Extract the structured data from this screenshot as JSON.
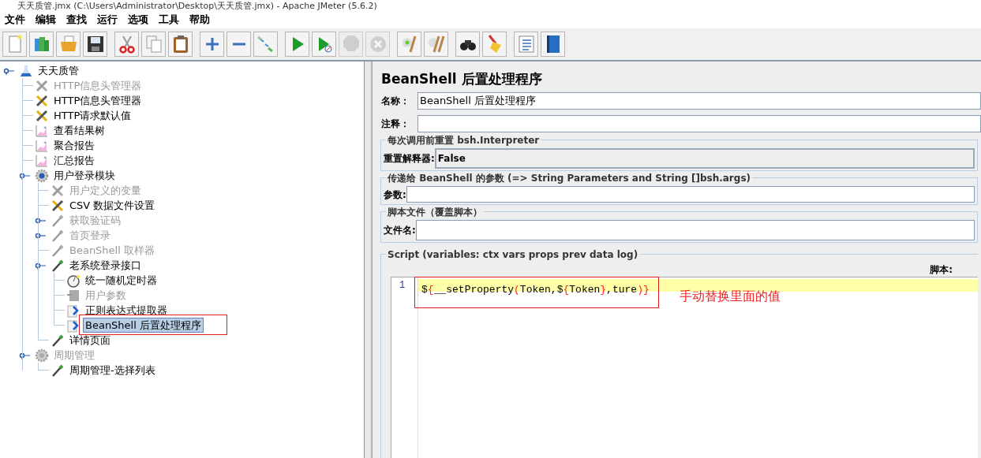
{
  "window": {
    "title": "天天质管.jmx (C:\\Users\\Administrator\\Desktop\\天天质管.jmx) - Apache JMeter (5.6.2)"
  },
  "menu": [
    "文件",
    "编辑",
    "查找",
    "运行",
    "选项",
    "工具",
    "帮助"
  ],
  "toolbar": [
    [
      {
        "kind": "new",
        "disabled": false
      },
      {
        "kind": "templates",
        "disabled": false
      },
      {
        "kind": "open",
        "disabled": false
      },
      {
        "kind": "save",
        "disabled": false
      }
    ],
    [
      {
        "kind": "cut",
        "disabled": false
      },
      {
        "kind": "copy",
        "disabled": false
      },
      {
        "kind": "paste",
        "disabled": false
      }
    ],
    [
      {
        "kind": "expand",
        "disabled": false
      },
      {
        "kind": "collapse",
        "disabled": false
      },
      {
        "kind": "toggle",
        "disabled": false
      }
    ],
    [
      {
        "kind": "start",
        "disabled": false
      },
      {
        "kind": "start-no-pause",
        "disabled": false
      },
      {
        "kind": "stop",
        "disabled": true
      },
      {
        "kind": "shutdown",
        "disabled": true
      }
    ],
    [
      {
        "kind": "clear",
        "disabled": false
      },
      {
        "kind": "clear-all",
        "disabled": false
      }
    ],
    [
      {
        "kind": "search",
        "disabled": false
      },
      {
        "kind": "reset-search",
        "disabled": false
      }
    ],
    [
      {
        "kind": "functions",
        "disabled": false
      },
      {
        "kind": "help",
        "disabled": false
      }
    ]
  ],
  "tree": [
    {
      "label": "天天质管",
      "kind": "plan",
      "disabled": false,
      "selected": false,
      "expanded": true,
      "children": [
        {
          "label": "HTTP信息头管理器",
          "kind": "config",
          "disabled": true,
          "selected": false
        },
        {
          "label": "HTTP信息头管理器",
          "kind": "config",
          "disabled": false,
          "selected": false
        },
        {
          "label": "HTTP请求默认值",
          "kind": "config",
          "disabled": false,
          "selected": false
        },
        {
          "label": "查看结果树",
          "kind": "listener",
          "disabled": false,
          "selected": false
        },
        {
          "label": "聚合报告",
          "kind": "listener",
          "disabled": false,
          "selected": false
        },
        {
          "label": "汇总报告",
          "kind": "listener",
          "disabled": false,
          "selected": false
        },
        {
          "label": "用户登录模块",
          "kind": "group",
          "disabled": false,
          "selected": false,
          "expanded": true,
          "children": [
            {
              "label": "用户定义的变量",
              "kind": "config",
              "disabled": true,
              "selected": false
            },
            {
              "label": "CSV 数据文件设置",
              "kind": "config",
              "disabled": false,
              "selected": false
            },
            {
              "label": "获取验证码",
              "kind": "sampler",
              "disabled": true,
              "selected": false,
              "expanded": false
            },
            {
              "label": "首页登录",
              "kind": "sampler",
              "disabled": true,
              "selected": false,
              "expanded": false
            },
            {
              "label": "BeanShell 取样器",
              "kind": "sampler",
              "disabled": true,
              "selected": false
            },
            {
              "label": "老系统登录接口",
              "kind": "sampler",
              "disabled": false,
              "selected": false,
              "expanded": true,
              "children": [
                {
                  "label": "统一随机定时器",
                  "kind": "timer",
                  "disabled": false,
                  "selected": false
                },
                {
                  "label": "用户参数",
                  "kind": "pre",
                  "disabled": true,
                  "selected": false
                },
                {
                  "label": "正则表达式提取器",
                  "kind": "post",
                  "disabled": false,
                  "selected": false
                },
                {
                  "label": "BeanShell 后置处理程序",
                  "kind": "post",
                  "disabled": false,
                  "selected": true
                }
              ]
            },
            {
              "label": "详情页面",
              "kind": "sampler",
              "disabled": false,
              "selected": false
            }
          ]
        },
        {
          "label": "周期管理",
          "kind": "group",
          "disabled": true,
          "selected": false,
          "expanded": true,
          "children": [
            {
              "label": "周期管理-选择列表",
              "kind": "sampler",
              "disabled": false,
              "selected": false
            }
          ]
        }
      ]
    }
  ],
  "panel": {
    "title": "BeanShell 后置处理程序",
    "name_label": "名称：",
    "name_value": "BeanShell 后置处理程序",
    "comment_label": "注释：",
    "reset_group": {
      "legend": "每次调用前重置 bsh.Interpreter",
      "label": "重置解释器:",
      "value": "False"
    },
    "params_group": {
      "legend": "传递给 BeanShell 的参数 (=> String Parameters and String []bsh.args)",
      "label": "参数:"
    },
    "file_group": {
      "legend": "脚本文件（覆盖脚本）",
      "label": "文件名:"
    },
    "script_group": {
      "legend": "Script (variables: ctx vars props prev data log)",
      "label": "脚本:",
      "lines": [
        {
          "number": "1",
          "tokens": [
            {
              "text": "$",
              "kind": "plain"
            },
            {
              "text": "{",
              "kind": "bracket"
            },
            {
              "text": "__setProperty",
              "kind": "plain"
            },
            {
              "text": "(",
              "kind": "bracket"
            },
            {
              "text": "Token,$",
              "kind": "plain"
            },
            {
              "text": "{",
              "kind": "bracket"
            },
            {
              "text": "Token",
              "kind": "plain"
            },
            {
              "text": "}",
              "kind": "bracket"
            },
            {
              "text": ",ture",
              "kind": "plain"
            },
            {
              "text": ")",
              "kind": "bracket"
            },
            {
              "text": "}",
              "kind": "bracket"
            }
          ]
        }
      ]
    }
  },
  "annotation": {
    "text": "手动替换里面的值"
  }
}
